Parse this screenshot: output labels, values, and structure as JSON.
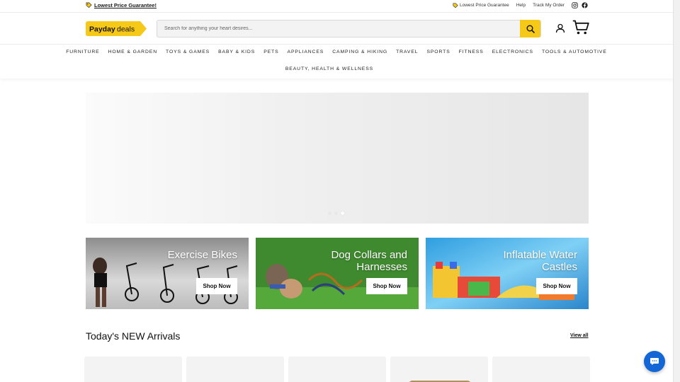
{
  "topbar": {
    "promo_text": "Lowest Price Guarantee!",
    "links": {
      "lowest_price": "Lowest Price Guarantee",
      "help": "Help",
      "track_order": "Track My Order"
    }
  },
  "header": {
    "logo_text_primary": "Payday",
    "logo_text_secondary": "deals",
    "search_placeholder": "Search for anything your heart desires..."
  },
  "nav": {
    "row1": [
      "FURNITURE",
      "HOME & GARDEN",
      "TOYS & GAMES",
      "BABY & KIDS",
      "PETS",
      "APPLIANCES",
      "CAMPING & HIKING",
      "TRAVEL",
      "SPORTS",
      "FITNESS",
      "ELECTRONICS",
      "TOOLS & AUTOMOTIVE"
    ],
    "row2": [
      "BEAUTY, HEALTH & WELLNESS"
    ]
  },
  "hero": {
    "slides": 3,
    "active_slide": 3
  },
  "tiles": [
    {
      "title": "Exercise Bikes",
      "button": "Shop Now"
    },
    {
      "title": "Dog Collars and Harnesses",
      "button": "Shop Now"
    },
    {
      "title": "Inflatable Water Castles",
      "button": "Shop Now"
    }
  ],
  "new_arrivals": {
    "title": "Today's NEW Arrivals",
    "view_all": "View all"
  },
  "colors": {
    "brand_yellow": "#f6c818",
    "chat_blue": "#1266d6"
  },
  "icons": [
    "tag-icon",
    "instagram-icon",
    "facebook-icon",
    "search-icon",
    "account-icon",
    "cart-icon",
    "chat-icon"
  ]
}
